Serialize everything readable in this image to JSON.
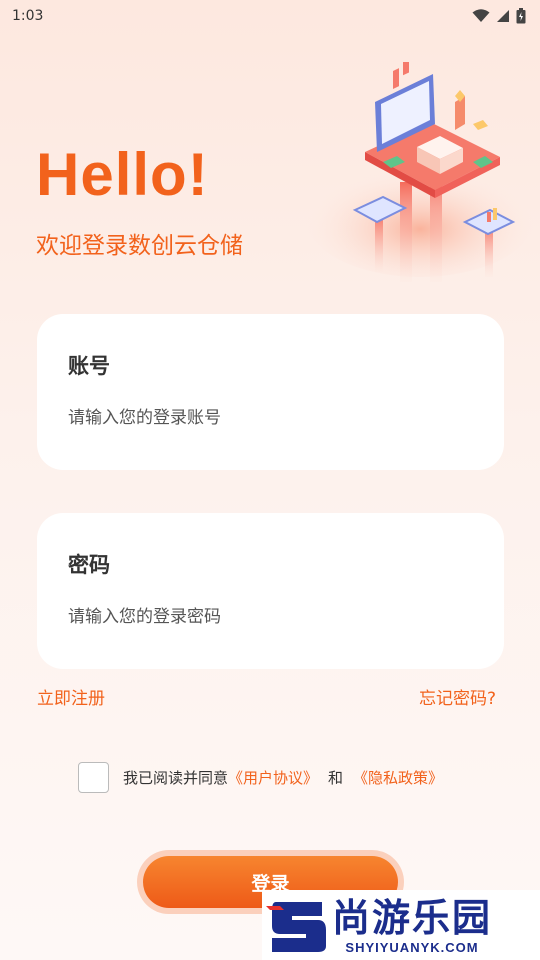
{
  "status_bar": {
    "time": "1:03"
  },
  "header": {
    "greeting": "Hello!",
    "subtitle": "欢迎登录数创云仓储"
  },
  "account": {
    "label": "账号",
    "placeholder": "请输入您的登录账号",
    "value": ""
  },
  "password": {
    "label": "密码",
    "placeholder": "请输入您的登录密码",
    "value": ""
  },
  "links": {
    "register": "立即注册",
    "forgot": "忘记密码?"
  },
  "agreement": {
    "checked": false,
    "prefix": "我已阅读并同意",
    "user_agreement": "《用户协议》",
    "and": "和",
    "privacy_policy": "《隐私政策》"
  },
  "login_button": "登录",
  "watermark": {
    "name": "尚游乐园",
    "domain": "SHYIYUANYK.COM"
  },
  "colors": {
    "accent": "#f2621c",
    "background_top": "#fde8df",
    "watermark_blue": "#1b2d8c"
  }
}
